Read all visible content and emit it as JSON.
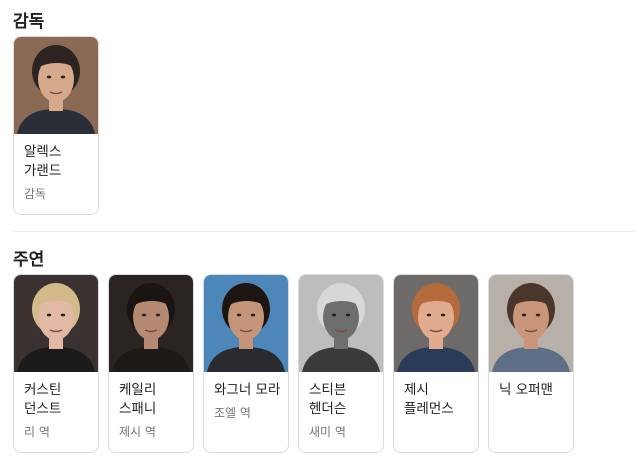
{
  "director_section": {
    "title": "감독",
    "people": [
      {
        "name": "알렉스 가랜드",
        "role": "감독",
        "photo_bg": "#8a6a55",
        "skin": "#d7a98c",
        "hair": "#2b2421",
        "shirt": "#2a2e36"
      }
    ]
  },
  "cast_section": {
    "title": "주연",
    "people": [
      {
        "name": "커스틴 던스트",
        "role": "리 역",
        "photo_bg": "#3a3130",
        "skin": "#e2b9a4",
        "hair": "#d4b98a",
        "shirt": "#1b1b1b"
      },
      {
        "name": "케일리 스패니",
        "role": "제시 역",
        "photo_bg": "#2a2422",
        "skin": "#b48a73",
        "hair": "#1a1412",
        "shirt": "#1e1a18"
      },
      {
        "name": "와그너 모라",
        "role": "조엘 역",
        "photo_bg": "#4d86b8",
        "skin": "#c49578",
        "hair": "#1d1512",
        "shirt": "#2a2b31"
      },
      {
        "name": "스티븐 헨더슨",
        "role": "새미 역",
        "photo_bg": "#bdbdbd",
        "skin": "#6e6e6e",
        "hair": "#d8d8d8",
        "shirt": "#3a3a3a"
      },
      {
        "name": "제시 플레먼스",
        "role": "",
        "photo_bg": "#6f6a6a",
        "skin": "#e0ab8e",
        "hair": "#b56a3c",
        "shirt": "#2b3b5a"
      },
      {
        "name": "닉 오퍼맨",
        "role": "",
        "photo_bg": "#b6b0a8",
        "skin": "#c9967a",
        "hair": "#4a362a",
        "shirt": "#5d6f86"
      }
    ]
  }
}
